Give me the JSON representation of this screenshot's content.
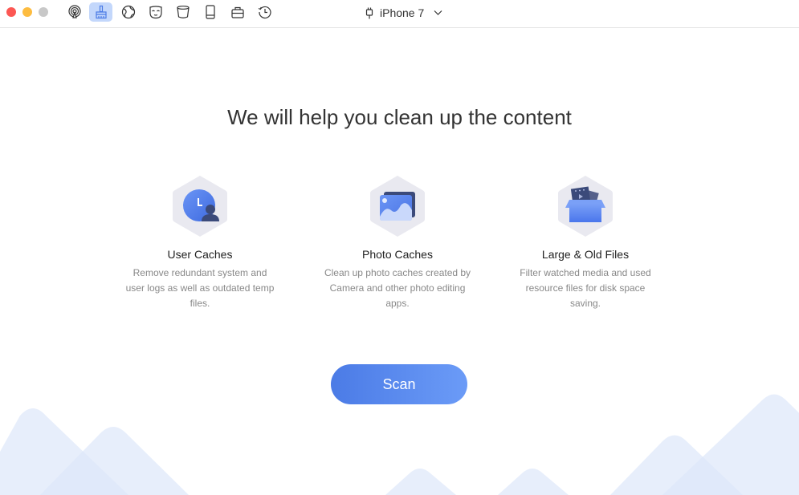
{
  "window": {
    "traffic_lights": [
      "close",
      "minimize",
      "maximize"
    ]
  },
  "toolbar": {
    "items": [
      {
        "name": "airplay-icon",
        "active": false
      },
      {
        "name": "clean-brush-icon",
        "active": true
      },
      {
        "name": "globe-icon",
        "active": false
      },
      {
        "name": "mask-icon",
        "active": false
      },
      {
        "name": "bucket-icon",
        "active": false
      },
      {
        "name": "device-icon",
        "active": false
      },
      {
        "name": "toolbox-icon",
        "active": false
      },
      {
        "name": "history-icon",
        "active": false
      }
    ],
    "device_name": "iPhone 7"
  },
  "main": {
    "heading": "We will help you clean up the content",
    "features": [
      {
        "icon": "user-caches-icon",
        "title": "User Caches",
        "description": "Remove redundant system and user logs as well as outdated temp files."
      },
      {
        "icon": "photo-caches-icon",
        "title": "Photo Caches",
        "description": "Clean up photo caches created by Camera and other photo editing apps."
      },
      {
        "icon": "large-old-files-icon",
        "title": "Large & Old Files",
        "description": "Filter watched media and used resource files for disk space saving."
      }
    ],
    "scan_label": "Scan"
  },
  "colors": {
    "accent": "#4b7be6",
    "accent_light": "#6b9bf7",
    "toolbar_active_bg": "#c3d7fb",
    "hex_bg": "#e9e9f0",
    "mountain": "#e6eefc"
  }
}
